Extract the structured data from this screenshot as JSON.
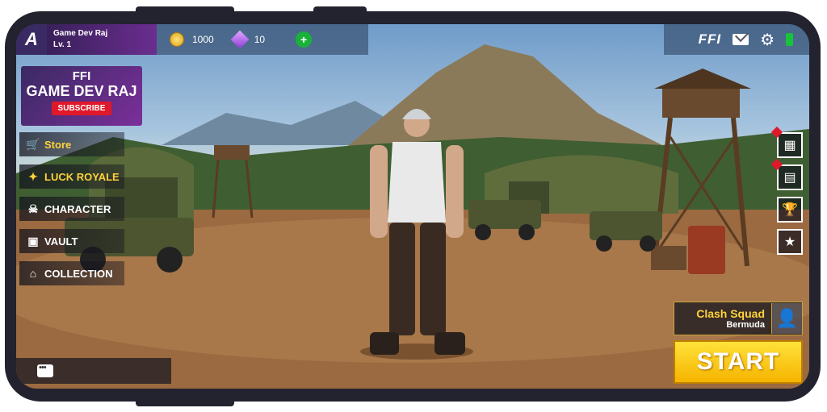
{
  "profile": {
    "name": "Game Dev Raj",
    "level": "Lv. 1",
    "logo": "A"
  },
  "currency": {
    "coins": "1000",
    "diamonds": "10",
    "add_icon": "+"
  },
  "topright": {
    "brand": "FFI",
    "mail_icon": "mail-icon",
    "settings_icon": "gear-icon",
    "battery_icon": "battery-icon"
  },
  "banner": {
    "line1": "FFI",
    "line2": "GAME DEV RAJ",
    "subscribe": "SUBSCRIBE"
  },
  "menu": {
    "items": [
      {
        "label": "Store",
        "icon": "cart-icon"
      },
      {
        "label": "LUCK ROYALE",
        "icon": "luck-icon"
      },
      {
        "label": "CHARACTER",
        "icon": "skull-icon"
      },
      {
        "label": "VAULT",
        "icon": "vault-icon"
      },
      {
        "label": "COLLECTION",
        "icon": "home-icon"
      }
    ]
  },
  "right_icons": [
    "calendar-icon",
    "clipboard-icon",
    "trophy-icon",
    "badge-icon"
  ],
  "mode": {
    "title": "Clash Squad",
    "map": "Bermuda"
  },
  "start_label": "START",
  "colors": {
    "accent_gold": "#ffd23a",
    "start_yellow": "#ffd100",
    "alert_red": "#e0182a",
    "profile_purple": "#6a2d8f"
  }
}
